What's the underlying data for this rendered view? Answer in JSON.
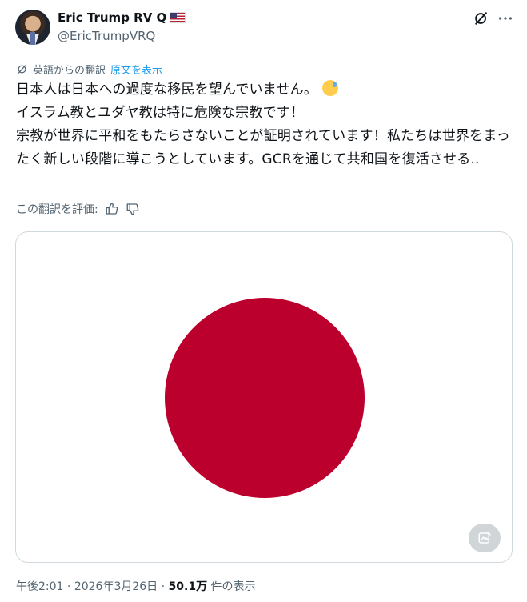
{
  "author": {
    "name": "Eric Trump RV Q",
    "handle": "@EricTrumpVRQ"
  },
  "translation": {
    "label": "英語からの翻訳",
    "show_original": "原文を表示",
    "rate_label": "この翻訳を評価:"
  },
  "post": {
    "text": "日本人は日本への過度な移民を望んでいません。",
    "line2": "イスラム教とユダヤ教は特に危険な宗教です！",
    "line3": "宗教が世界に平和をもたらさないことが証明されています！私たちは世界をまったく新しい段階に導こうとしています。GCRを通じて共和国を復活させる..",
    "emoji": "sweat-smile-emoji"
  },
  "media": {
    "image_subject": "japan-flag",
    "colors": {
      "disc": "#bc002d",
      "field": "#ffffff"
    }
  },
  "meta": {
    "time": "午後2:01",
    "sep1": " · ",
    "date": "2026年3月26日",
    "sep2": " · ",
    "views": "50.1万",
    "views_suffix": " 件の表示"
  },
  "icons": {
    "grok": "grok-icon",
    "more": "more-icon",
    "translate": "translate-icon",
    "thumbs_up": "thumbs-up-icon",
    "thumbs_down": "thumbs-down-icon",
    "alt": "image-alt-icon"
  },
  "colors": {
    "link": "#1d9bf0",
    "muted": "#536471",
    "text": "#0f1419",
    "border": "#cfd9de"
  }
}
